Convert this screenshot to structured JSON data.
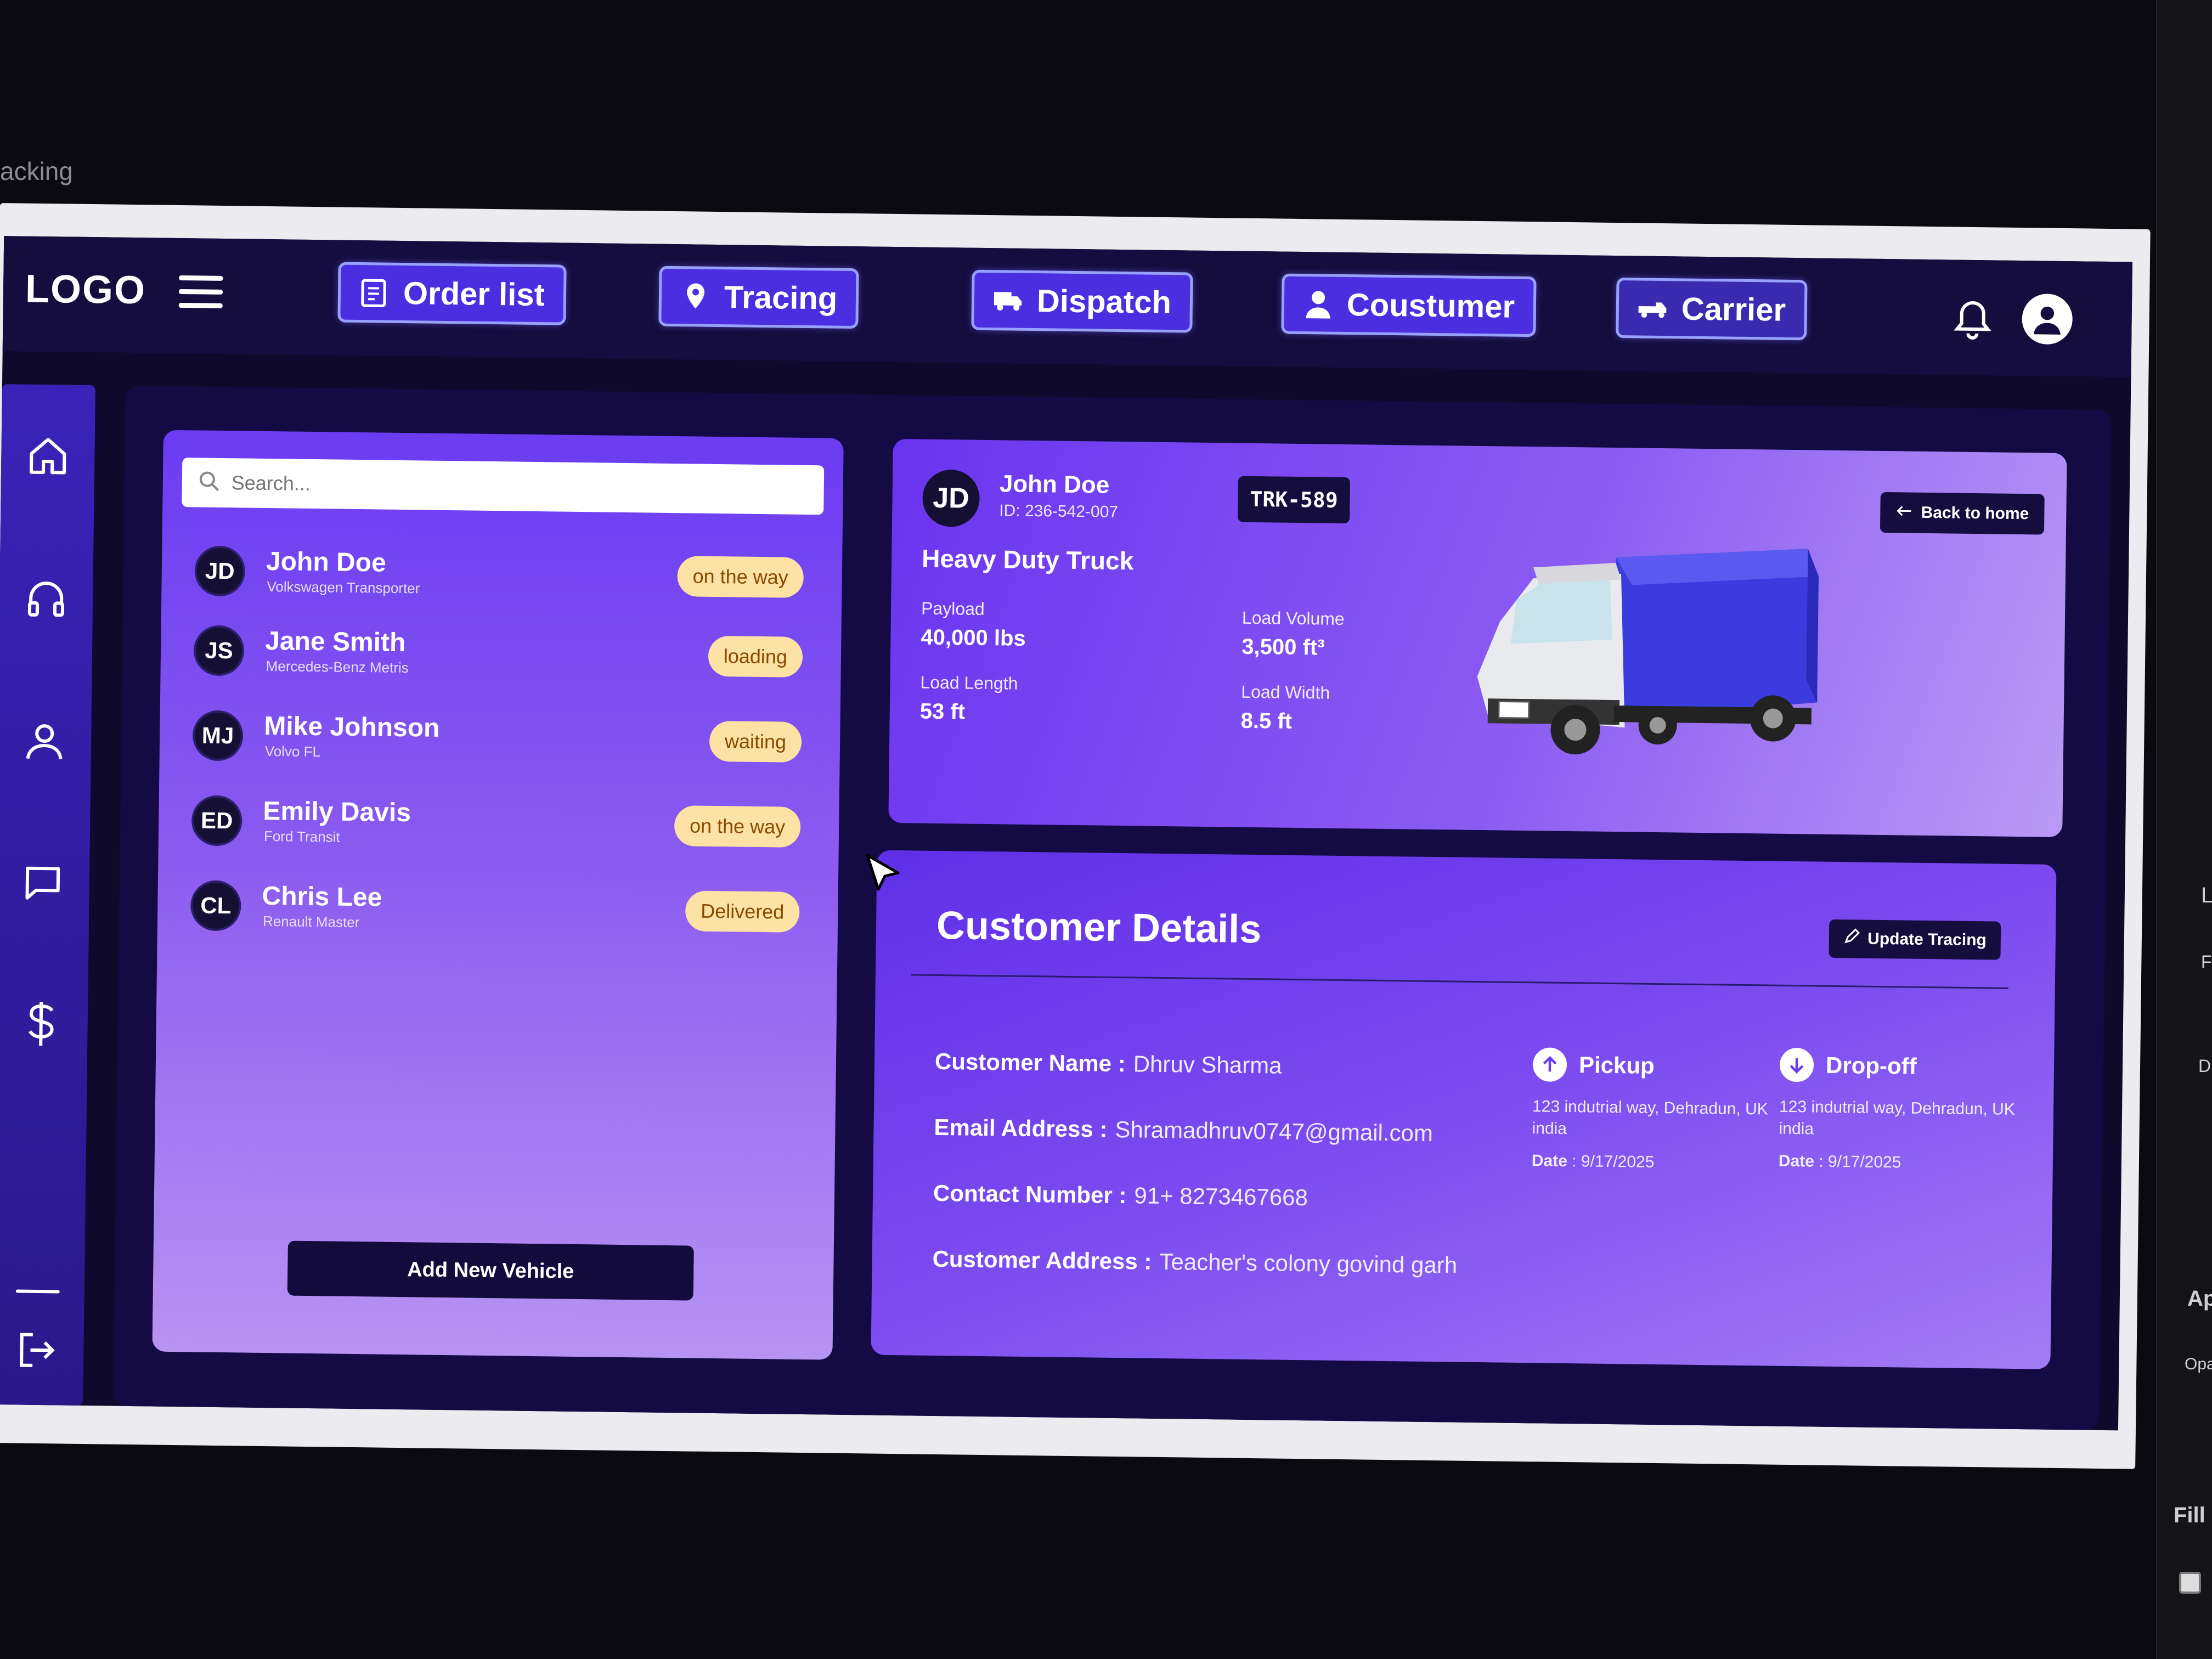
{
  "window": {
    "caption": "acking"
  },
  "header": {
    "logo": "LOGO",
    "nav": [
      {
        "label": "Order list",
        "icon": "clipboard-list-icon"
      },
      {
        "label": "Tracing",
        "icon": "map-pin-icon"
      },
      {
        "label": "Dispatch",
        "icon": "truck-icon"
      },
      {
        "label": "Coustumer",
        "icon": "user-icon"
      },
      {
        "label": "Carrier",
        "icon": "carrier-truck-icon"
      }
    ]
  },
  "sidebar": {
    "items": [
      "home-icon",
      "headset-icon",
      "user-icon",
      "message-icon",
      "dollar-icon",
      "logout-icon"
    ]
  },
  "search": {
    "placeholder": "Search..."
  },
  "drivers": [
    {
      "initials": "JD",
      "name": "John Doe",
      "vehicle": "Volkswagen Transporter",
      "status": "on the way"
    },
    {
      "initials": "JS",
      "name": "Jane Smith",
      "vehicle": "Mercedes-Benz Metris",
      "status": "loading"
    },
    {
      "initials": "MJ",
      "name": "Mike Johnson",
      "vehicle": "Volvo FL",
      "status": "waiting"
    },
    {
      "initials": "ED",
      "name": "Emily Davis",
      "vehicle": "Ford Transit",
      "status": "on the way"
    },
    {
      "initials": "CL",
      "name": "Chris Lee",
      "vehicle": "Renault Master",
      "status": "Delivered"
    }
  ],
  "add_vehicle_label": "Add New Vehicle",
  "vehicle": {
    "initials": "JD",
    "driver_name": "John Doe",
    "driver_id": "ID: 236-542-007",
    "truck_code": "TRK-589",
    "back_label": "Back to home",
    "type": "Heavy Duty Truck",
    "payload_label": "Payload",
    "payload": "40,000 lbs",
    "load_volume_label": "Load Volume",
    "load_volume": "3,500 ft³",
    "load_length_label": "Load Length",
    "load_length": "53 ft",
    "load_width_label": "Load Width",
    "load_width": "8.5 ft"
  },
  "customer": {
    "title": "Customer Details",
    "update_label": "Update Tracing",
    "name_label": "Customer Name :",
    "name": "Dhruv Sharma",
    "email_label": "Email Address :",
    "email": "Shramadhruv0747@gmail.com",
    "contact_label": "Contact Number :",
    "contact": "91+ 8273467668",
    "address_label": "Customer Address :",
    "address": "Teacher's colony govind garh",
    "pickup": {
      "label": "Pickup",
      "address": "123 indutrial way, Dehradun, UK india",
      "date_label": "Date",
      "date": ": 9/17/2025"
    },
    "dropoff": {
      "label": "Drop-off",
      "address": "123 indutrial way, Dehradun, UK india",
      "date_label": "Date",
      "date": ": 9/17/2025"
    }
  },
  "side_panel": {
    "labels": [
      "L",
      "Fi",
      "Di",
      "Ap",
      "Opa",
      "Fill"
    ]
  },
  "colors": {
    "accent": "#4a2ee0",
    "nav_bg": "#140d3d",
    "status_badge": "#fde2a6"
  }
}
